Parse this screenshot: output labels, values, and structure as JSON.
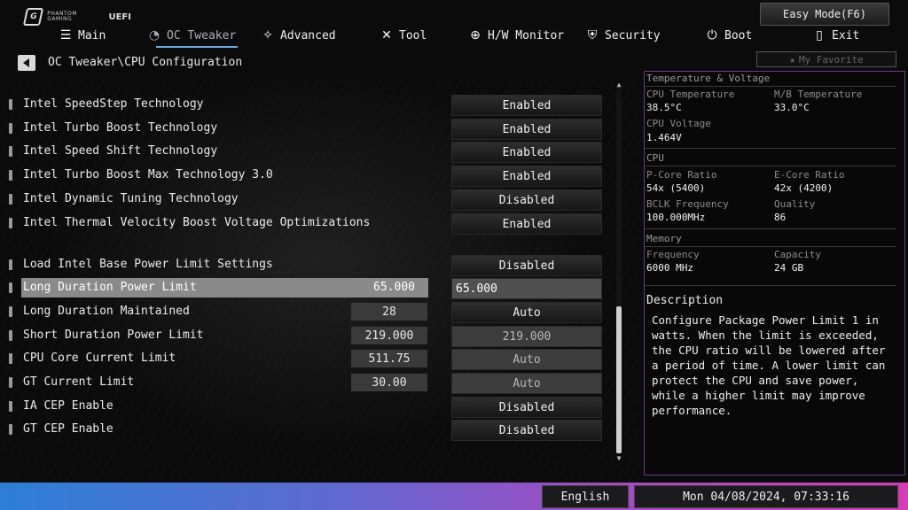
{
  "header": {
    "brand_small": "PHANTOM GAMING",
    "brand_mark": "G",
    "uefi": "UEFI",
    "easy_mode": "Easy Mode(F6)"
  },
  "tabs": [
    {
      "label": "Main",
      "icon": "list-icon"
    },
    {
      "label": "OC Tweaker",
      "icon": "speedometer-icon",
      "active": true
    },
    {
      "label": "Advanced",
      "icon": "star-arrow-icon"
    },
    {
      "label": "Tool",
      "icon": "tools-icon"
    },
    {
      "label": "H/W Monitor",
      "icon": "target-icon"
    },
    {
      "label": "Security",
      "icon": "shield-icon"
    },
    {
      "label": "Boot",
      "icon": "power-icon"
    },
    {
      "label": "Exit",
      "icon": "exit-door-icon"
    }
  ],
  "breadcrumb": "OC Tweaker\\CPU Configuration",
  "favorite": {
    "label": "My Favorite",
    "icon": "star-icon"
  },
  "settings": [
    {
      "label": "Intel SpeedStep Technology",
      "value": "",
      "option": "Enabled"
    },
    {
      "label": "Intel Turbo Boost Technology",
      "value": "",
      "option": "Enabled"
    },
    {
      "label": "Intel Speed Shift Technology",
      "value": "",
      "option": "Enabled"
    },
    {
      "label": "Intel Turbo Boost Max Technology 3.0",
      "value": "",
      "option": "Enabled"
    },
    {
      "label": "Intel Dynamic Tuning Technology",
      "value": "",
      "option": "Disabled"
    },
    {
      "label": "Intel Thermal Velocity Boost Voltage Optimizations",
      "value": "",
      "option": "Enabled"
    },
    {
      "label": "Load Intel Base Power Limit Settings",
      "value": "",
      "option": "Disabled"
    },
    {
      "label": "Long Duration Power Limit",
      "value": "65.000",
      "option": "65.000",
      "selected": true
    },
    {
      "label": "Long Duration Maintained",
      "value": "28",
      "option": "Auto"
    },
    {
      "label": "Short Duration Power Limit",
      "value": "219.000",
      "option": "219.000"
    },
    {
      "label": "CPU Core Current Limit",
      "value": "511.75",
      "option": "Auto"
    },
    {
      "label": "GT Current Limit",
      "value": "30.00",
      "option": "Auto"
    },
    {
      "label": "IA CEP Enable",
      "value": "",
      "option": "Disabled"
    },
    {
      "label": "GT CEP Enable",
      "value": "",
      "option": "Disabled"
    }
  ],
  "scroll": {
    "up": "▲",
    "down": "▼"
  },
  "monitor": {
    "tv_title": "Temperature & Voltage",
    "cpu_temp_label": "CPU Temperature",
    "cpu_temp": "38.5°C",
    "mb_temp_label": "M/B Temperature",
    "mb_temp": "33.0°C",
    "cpu_volt_label": "CPU Voltage",
    "cpu_volt": "1.464V",
    "cpu_title": "CPU",
    "pcore_label": "P-Core Ratio",
    "pcore": "54x (5400)",
    "ecore_label": "E-Core Ratio",
    "ecore": "42x (4200)",
    "bclk_label": "BCLK Frequency",
    "bclk": "100.000MHz",
    "quality_label": "Quality",
    "quality": "86",
    "mem_title": "Memory",
    "freq_label": "Frequency",
    "freq": "6000 MHz",
    "cap_label": "Capacity",
    "cap": "24 GB"
  },
  "description": {
    "title": "Description",
    "body": "Configure Package Power Limit 1 in watts. When the limit is exceeded, the CPU ratio will be lowered after a period of time. A lower limit can protect the CPU and save power, while a higher limit may improve performance."
  },
  "footer": {
    "language": "English",
    "datetime": "Mon 04/08/2024, 07:33:16"
  }
}
